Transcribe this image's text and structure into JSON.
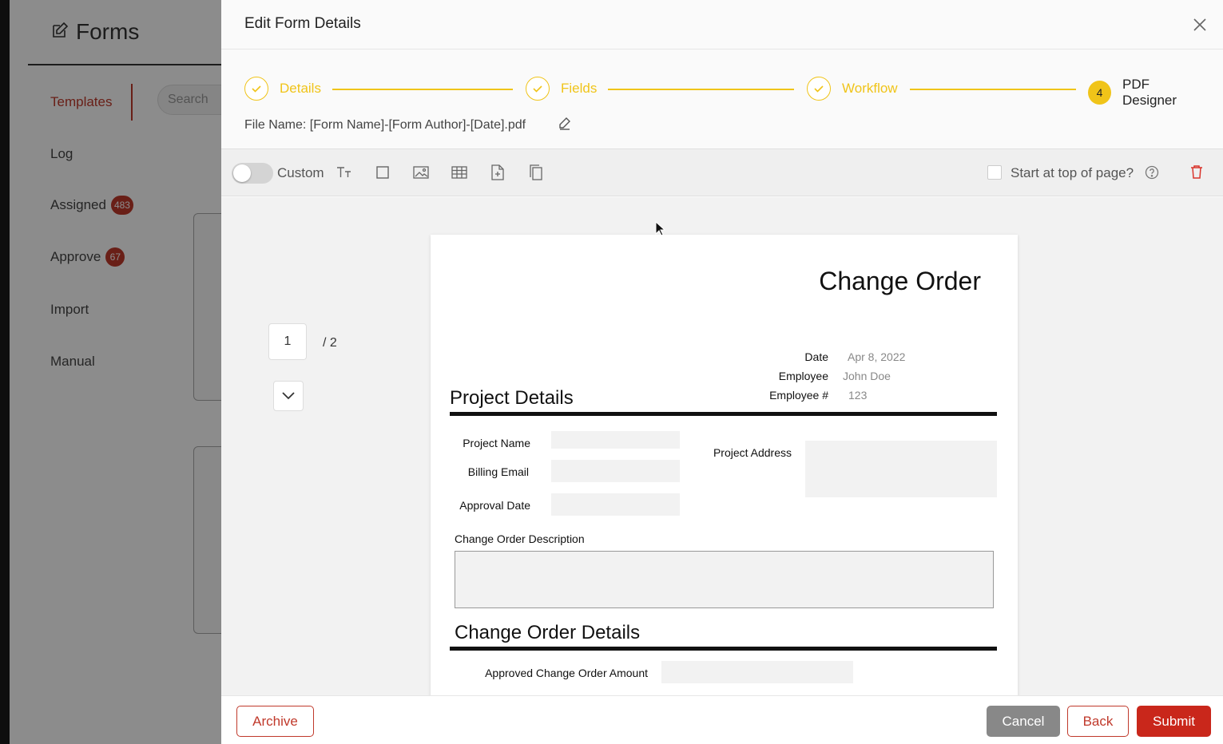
{
  "app": {
    "title": "Forms",
    "search_placeholder": "Search",
    "nav": [
      {
        "label": "Templates",
        "badge": ""
      },
      {
        "label": "Log",
        "badge": ""
      },
      {
        "label": "Assigned",
        "badge": "483"
      },
      {
        "label": "Approve",
        "badge": "67"
      },
      {
        "label": "Import",
        "badge": ""
      },
      {
        "label": "Manual",
        "badge": ""
      }
    ]
  },
  "modal": {
    "title": "Edit Form Details",
    "steps": [
      {
        "label": "Details",
        "status": "complete"
      },
      {
        "label": "Fields",
        "status": "complete"
      },
      {
        "label": "Workflow",
        "status": "complete"
      },
      {
        "label": "PDF Designer",
        "number": "4",
        "status": "current"
      }
    ],
    "file_name": "File Name: [Form Name]-[Form Author]-[Date].pdf",
    "accent_color": "#f0c419",
    "brand_color": "#c0392b"
  },
  "toolbar": {
    "custom_label": "Custom",
    "start_top_label": "Start at top of page?"
  },
  "pager": {
    "current_page": "1",
    "total": "/ 2"
  },
  "pdf": {
    "title": "Change Order",
    "meta": [
      {
        "label": "Date",
        "value": "Apr 8, 2022"
      },
      {
        "label": "Employee",
        "value": "John Doe"
      },
      {
        "label": "Employee #",
        "value": "123"
      }
    ],
    "project_details_title": "Project Details",
    "project_fields": {
      "project_name": "Project Name",
      "billing_email": "Billing Email",
      "approval_date": "Approval Date",
      "project_address": "Project Address"
    },
    "description_label": "Change Order Description",
    "change_order_details_title": "Change Order Details",
    "approved_amount_label": "Approved Change Order Amount"
  },
  "footer": {
    "archive": "Archive",
    "cancel": "Cancel",
    "back": "Back",
    "submit": "Submit"
  }
}
